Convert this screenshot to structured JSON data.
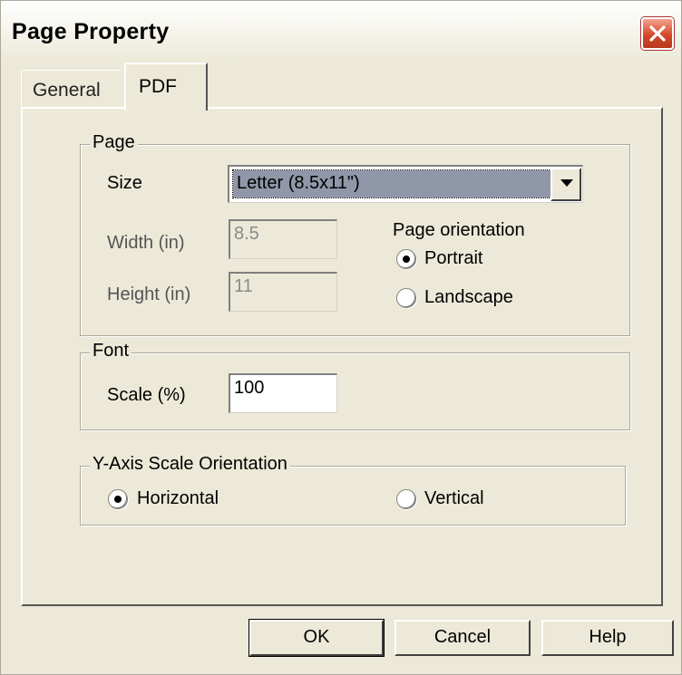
{
  "window": {
    "title": "Page Property",
    "close_icon": "close-icon"
  },
  "tabs": [
    {
      "label": "General",
      "active": false
    },
    {
      "label": "PDF",
      "active": true
    }
  ],
  "page_group": {
    "legend": "Page",
    "size_label": "Size",
    "size_value": "Letter (8.5x11\")",
    "width_label": "Width (in)",
    "width_value": "8.5",
    "height_label": "Height (in)",
    "height_value": "11",
    "orientation_label": "Page orientation",
    "portrait_label": "Portrait",
    "landscape_label": "Landscape",
    "orientation_selected": "Portrait"
  },
  "font_group": {
    "legend": "Font",
    "scale_label": "Scale (%)",
    "scale_value": "100"
  },
  "yaxis_group": {
    "legend": "Y-Axis Scale Orientation",
    "horizontal_label": "Horizontal",
    "vertical_label": "Vertical",
    "selected": "Horizontal"
  },
  "buttons": {
    "ok": "OK",
    "cancel": "Cancel",
    "help": "Help"
  },
  "colors": {
    "close_button": "#d4482a",
    "selection": "#8f97a8",
    "dialog_bg": "#ece9d8"
  }
}
